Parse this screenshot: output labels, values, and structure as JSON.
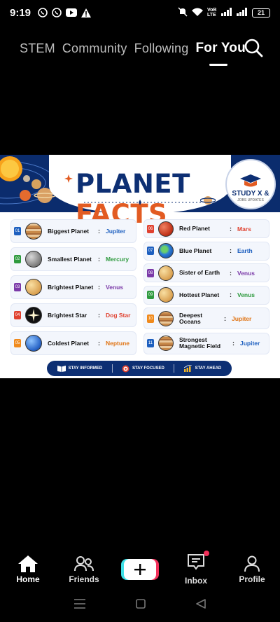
{
  "status_bar": {
    "time": "9:19",
    "network": "VoB LTE",
    "battery": "21"
  },
  "tabs": [
    {
      "label": "STEM",
      "active": false
    },
    {
      "label": "Community",
      "active": false
    },
    {
      "label": "Following",
      "active": false
    },
    {
      "label": "For You",
      "active": true
    }
  ],
  "poster": {
    "title_part1": "PLANET ",
    "title_part2": "FACTS",
    "logo_title": "STUDY X &",
    "logo_sub": "JOBS UPDATES",
    "colors": {
      "navy": "#0d2f73",
      "orange": "#e25b22"
    },
    "left_facts": [
      {
        "num": "01",
        "label": "Biggest Planet",
        "value": "Jupiter",
        "num_color": "#1d5fbf",
        "value_color": "#1d5fbf",
        "planet": "jupiter"
      },
      {
        "num": "02",
        "label": "Smallest Planet",
        "value": "Mercury",
        "num_color": "#2e9a3e",
        "value_color": "#2e9a3e",
        "planet": "mercury"
      },
      {
        "num": "03",
        "label": "Brightest Planet",
        "value": "Venus",
        "num_color": "#7b3aa8",
        "value_color": "#7b3aa8",
        "planet": "venus"
      },
      {
        "num": "04",
        "label": "Brightest Star",
        "value": "Dog Star",
        "num_color": "#e0412f",
        "value_color": "#e0412f",
        "planet": "star"
      },
      {
        "num": "05",
        "label": "Coldest Planet",
        "value": "Neptune",
        "num_color": "#f08a1c",
        "value_color": "#e07414",
        "planet": "neptune"
      }
    ],
    "right_facts": [
      {
        "num": "06",
        "label": "Red Planet",
        "value": "Mars",
        "num_color": "#e0412f",
        "value_color": "#e0412f",
        "planet": "mars"
      },
      {
        "num": "07",
        "label": "Blue Planet",
        "value": "Earth",
        "num_color": "#1d5fbf",
        "value_color": "#1d5fbf",
        "planet": "earth"
      },
      {
        "num": "08",
        "label": "Sister of Earth",
        "value": "Venus",
        "num_color": "#7b3aa8",
        "value_color": "#7b3aa8",
        "planet": "venus"
      },
      {
        "num": "09",
        "label": "Hottest Planet",
        "value": "Venus",
        "num_color": "#2e9a3e",
        "value_color": "#2e9a3e",
        "planet": "venus"
      },
      {
        "num": "10",
        "label": "Deepest Oceans",
        "value": "Jupiter",
        "num_color": "#f08a1c",
        "value_color": "#e07414",
        "planet": "jupiter"
      },
      {
        "num": "11",
        "label": "Strongest Magnetic Field",
        "value": "Jupiter",
        "num_color": "#1d5fbf",
        "value_color": "#1d5fbf",
        "planet": "jupiter"
      }
    ],
    "footer": [
      "STAY INFORMED",
      "STAY FOCUSED",
      "STAY AHEAD"
    ]
  },
  "bottom_nav": [
    {
      "label": "Home",
      "icon": "home-icon"
    },
    {
      "label": "Friends",
      "icon": "friends-icon"
    },
    {
      "label": "",
      "icon": "plus-icon"
    },
    {
      "label": "Inbox",
      "icon": "inbox-icon"
    },
    {
      "label": "Profile",
      "icon": "profile-icon"
    }
  ]
}
